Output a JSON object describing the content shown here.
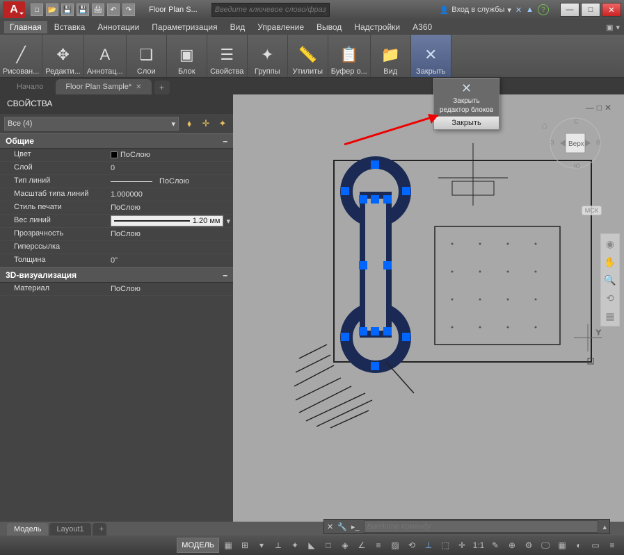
{
  "title": "Floor Plan S...",
  "search_placeholder": "Введите ключевое слово/фразу",
  "signin": "Вход в службы",
  "menu": [
    "Главная",
    "Вставка",
    "Аннотации",
    "Параметризация",
    "Вид",
    "Управление",
    "Вывод",
    "Надстройки",
    "A360"
  ],
  "ribbon": [
    {
      "label": "Рисован...",
      "icon": "╱"
    },
    {
      "label": "Редакти...",
      "icon": "✥"
    },
    {
      "label": "Аннотац...",
      "icon": "A"
    },
    {
      "label": "Слои",
      "icon": "❏"
    },
    {
      "label": "Блок",
      "icon": "▣"
    },
    {
      "label": "Свойства",
      "icon": "☰"
    },
    {
      "label": "Группы",
      "icon": "✦"
    },
    {
      "label": "Утилиты",
      "icon": "📏"
    },
    {
      "label": "Буфер о...",
      "icon": "📋"
    },
    {
      "label": "Вид",
      "icon": "📁"
    },
    {
      "label": "Закрыть",
      "icon": "✕",
      "active": true
    }
  ],
  "doc_tabs": {
    "start": "Начало",
    "main": "Floor Plan Sample*"
  },
  "props": {
    "title": "СВОЙСТВА",
    "selector": "Все (4)",
    "sections": {
      "general": "Общие",
      "viz": "3D-визуализация"
    },
    "rows": {
      "color": {
        "k": "Цвет",
        "v": "ПоСлою"
      },
      "layer": {
        "k": "Слой",
        "v": "0"
      },
      "ltype": {
        "k": "Тип линий",
        "v": "ПоСлою"
      },
      "ltscale": {
        "k": "Масштаб типа линий",
        "v": "1.000000"
      },
      "pstyle": {
        "k": "Стиль печати",
        "v": "ПоСлою"
      },
      "lweight": {
        "k": "Вес линий",
        "v": "1.20 мм"
      },
      "transp": {
        "k": "Прозрачность",
        "v": "ПоСлою"
      },
      "hyper": {
        "k": "Гиперссылка",
        "v": ""
      },
      "thick": {
        "k": "Толщина",
        "v": "0\""
      },
      "material": {
        "k": "Материал",
        "v": "ПоСлою"
      }
    }
  },
  "close_popup": {
    "line1": "Закрыть",
    "line2": "редактор блоков",
    "button": "Закрыть"
  },
  "cmd_placeholder": "Введите команду",
  "model_tabs": {
    "model": "Модель",
    "layout": "Layout1"
  },
  "status_model": "МОДЕЛЬ",
  "status_scale": "1:1",
  "viewcube": "Верх",
  "ucs": "МСК"
}
